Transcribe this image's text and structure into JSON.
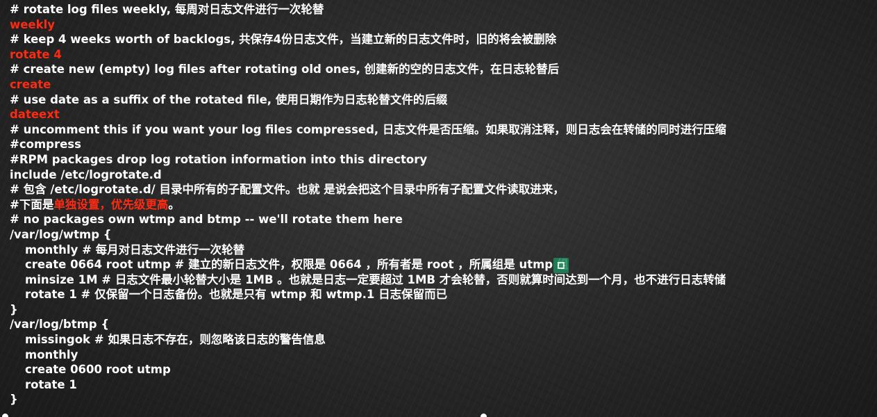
{
  "lines": [
    {
      "text": "# rotate log files weekly, 每周对日志文件进行一次轮替",
      "style": "comment"
    },
    {
      "text": "weekly",
      "style": "red"
    },
    {
      "text": "# keep 4 weeks worth of backlogs, 共保存4份日志文件，当建立新的日志文件时，旧的将会被删除",
      "style": "comment"
    },
    {
      "text": "rotate 4",
      "style": "red"
    },
    {
      "text": "# create new (empty) log files after rotating old ones, 创建新的空的日志文件，在日志轮替后",
      "style": "comment"
    },
    {
      "text": "create",
      "style": "red"
    },
    {
      "text": "# use date as a suffix of the rotated file, 使用日期作为日志轮替文件的后缀",
      "style": "comment"
    },
    {
      "text": "dateext",
      "style": "red"
    },
    {
      "text": "# uncomment this if you want your log files compressed, 日志文件是否压缩。如果取消注释，则日志会在转储的同时进行压缩",
      "style": "comment"
    },
    {
      "text": "#compress",
      "style": "comment"
    },
    {
      "text": "#RPM packages drop log rotation information into this directory",
      "style": "comment"
    },
    {
      "text": "include /etc/logrotate.d",
      "style": "plain"
    },
    {
      "text": "# 包含 /etc/logrotate.d/ 目录中所有的子配置文件。也就 是说会把这个目录中所有子配置文件读取进来，",
      "style": "comment"
    },
    {
      "text_prefix": "#下面是",
      "text_red": "单独设置，优先级更高",
      "text_suffix": "。",
      "style": "mixed"
    },
    {
      "text": "# no packages own wtmp and btmp -- we'll rotate them here",
      "style": "comment"
    },
    {
      "text": "/var/log/wtmp {",
      "style": "plain"
    },
    {
      "text": "monthly # 每月对日志文件进行一次轮替",
      "style": "indent"
    },
    {
      "text": "create 0664 root utmp # 建立的新日志文件，权限是 0664 ，所有者是 root ，所属组是 utmp 组",
      "style": "indent"
    },
    {
      "text": "minsize 1M   # 日志文件最小轮替大小是 1MB 。也就是日志一定要超过 1MB 才会轮替，否则就算时间达到一个月，也不进行日志转储",
      "style": "indent"
    },
    {
      "text": "rotate 1 # 仅保留一个日志备份。也就是只有 wtmp 和 wtmp.1 日志保留而已",
      "style": "indent"
    },
    {
      "text": "}",
      "style": "plain"
    },
    {
      "text": "/var/log/btmp {",
      "style": "plain"
    },
    {
      "text": "missingok # 如果日志不存在，则忽略该日志的警告信息",
      "style": "indent"
    },
    {
      "text": "monthly",
      "style": "indent"
    },
    {
      "text": "create 0600 root utmp",
      "style": "indent"
    },
    {
      "text": "rotate 1",
      "style": "indent"
    },
    {
      "text": "}",
      "style": "plain"
    }
  ],
  "colors": {
    "text": "#ffffff",
    "highlight": "#ff2a12",
    "background": "#2a2a2a"
  }
}
